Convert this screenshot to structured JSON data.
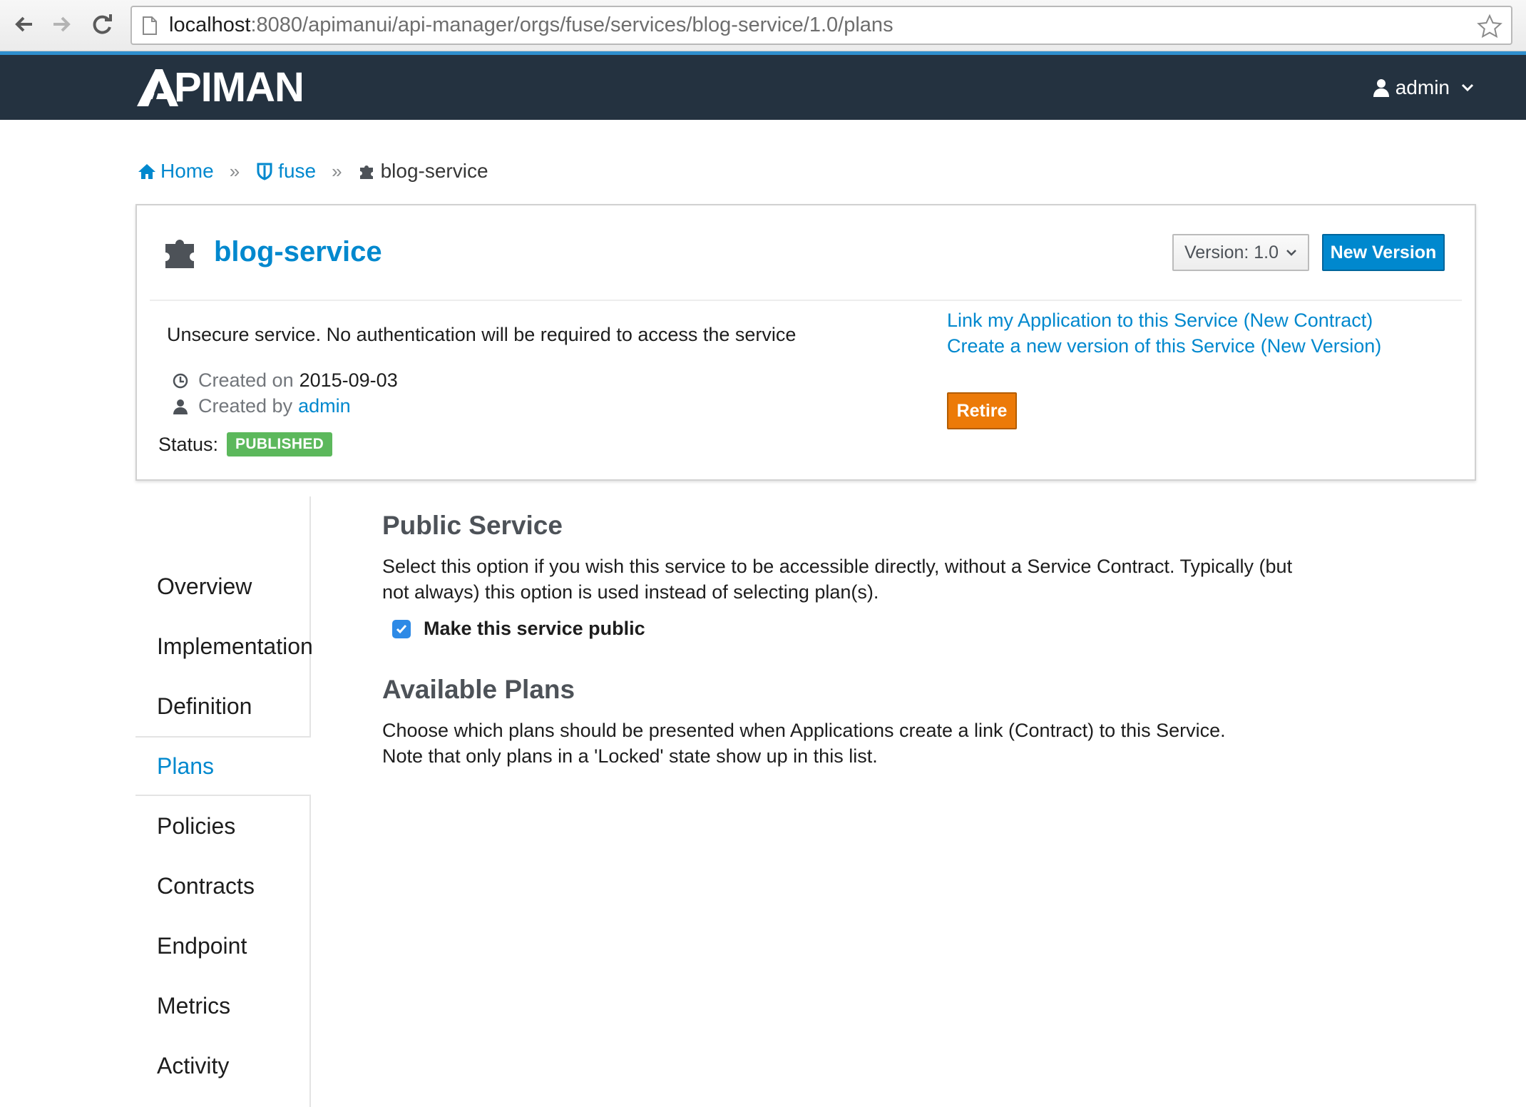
{
  "browser": {
    "url_host": "localhost",
    "url_rest": ":8080/apimanui/api-manager/orgs/fuse/services/blog-service/1.0/plans"
  },
  "header": {
    "logo_text": "PIMAN",
    "user": "admin"
  },
  "breadcrumb": {
    "home": "Home",
    "org": "fuse",
    "current": "blog-service",
    "separator": "»"
  },
  "service": {
    "name": "blog-service",
    "version_label": "Version: 1.0",
    "new_version_label": "New Version",
    "description": "Unsecure service. No authentication will be required to access the service",
    "created_on_label": "Created on",
    "created_on": "2015-09-03",
    "created_by_label": "Created by",
    "created_by": "admin",
    "status_label": "Status:",
    "status": "PUBLISHED",
    "link_contract": "Link my Application to this Service (New Contract)",
    "link_new_version": "Create a new version of this Service (New Version)",
    "retire_label": "Retire"
  },
  "sidenav": {
    "items": [
      {
        "label": "Overview"
      },
      {
        "label": "Implementation"
      },
      {
        "label": "Definition"
      },
      {
        "label": "Plans"
      },
      {
        "label": "Policies"
      },
      {
        "label": "Contracts"
      },
      {
        "label": "Endpoint"
      },
      {
        "label": "Metrics"
      },
      {
        "label": "Activity"
      }
    ],
    "active": "Plans"
  },
  "main": {
    "public_title": "Public Service",
    "public_desc": "Select this option if you wish this service to be accessible directly, without a Service Contract. Typically (but not always) this option is used instead of selecting plan(s).",
    "public_checkbox_label": "Make this service public",
    "public_checked": true,
    "plans_title": "Available Plans",
    "plans_desc_1": "Choose which plans should be presented when Applications create a link (Contract) to this Service.",
    "plans_desc_2": "Note that only plans in a 'Locked' state show up in this list."
  },
  "colors": {
    "brand_blue": "#0088ce",
    "header_bg": "#243240",
    "status_green": "#5cb85c",
    "retire_orange": "#ec7a08"
  },
  "icons": [
    "back-arrow-icon",
    "forward-arrow-icon",
    "reload-icon",
    "page-icon",
    "star-icon",
    "apiman-logo-icon",
    "user-icon",
    "chevron-down-icon",
    "home-icon",
    "shield-icon",
    "puzzle-icon",
    "clock-icon",
    "checkbox-checked-icon"
  ]
}
